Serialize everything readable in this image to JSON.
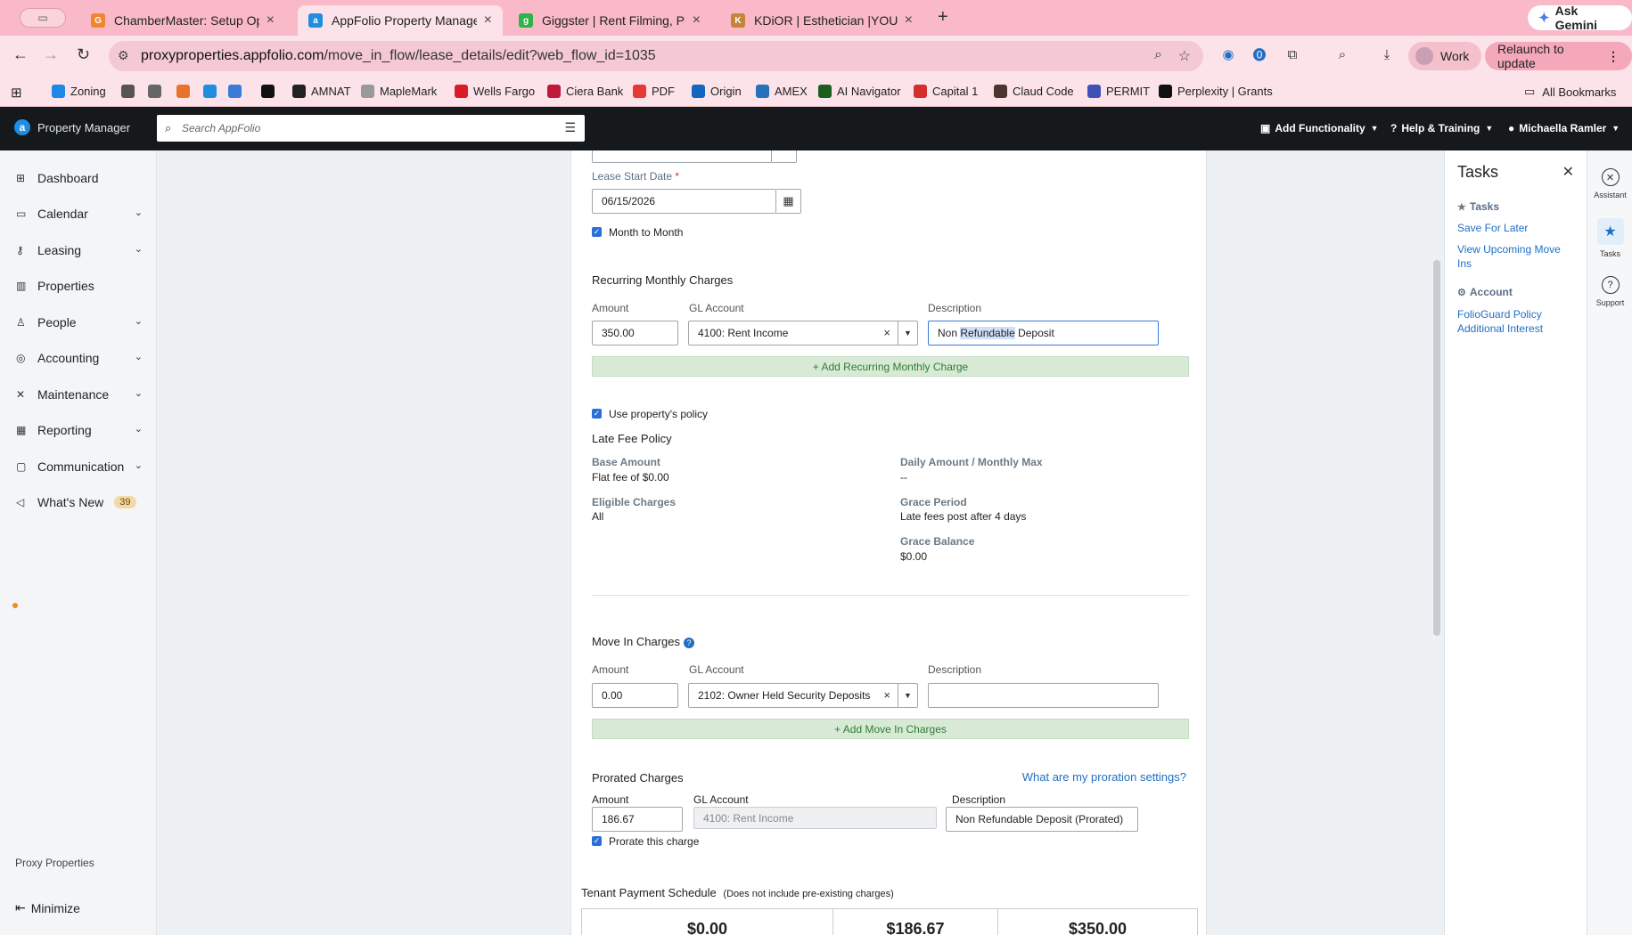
{
  "browser": {
    "tabs": [
      {
        "title": "ChamberMaster: Setup Optio",
        "icon": "chambermaster-icon",
        "color": "#f4842e",
        "glyph": "G"
      },
      {
        "title": "AppFolio Property Manager",
        "icon": "appfolio-icon",
        "color": "#1f8ee0",
        "glyph": "a"
      },
      {
        "title": "Giggster | Rent Filming, Photo",
        "icon": "giggster-icon",
        "color": "#2fb24a",
        "glyph": "g"
      },
      {
        "title": "KDiOR | Esthetician |YOU DE",
        "icon": "kdior-icon",
        "color": "#c4843a",
        "glyph": "K"
      }
    ],
    "gemini_label": "Ask Gemini",
    "url_host": "proxyproperties.appfolio.com",
    "url_path": "/move_in_flow/lease_details/edit?web_flow_id=1035",
    "work_label": "Work",
    "relaunch_label": "Relaunch to update",
    "bookmarks": [
      {
        "label": "Zoning",
        "color": "#1e88e5"
      },
      {
        "label": "",
        "color": "#555"
      },
      {
        "label": "",
        "color": "#666"
      },
      {
        "label": "",
        "color": "#e8742b"
      },
      {
        "label": "",
        "color": "#1f8ee0"
      },
      {
        "label": "",
        "color": "#3a7bd5"
      },
      {
        "label": "",
        "color": "#111"
      },
      {
        "label": "AMNAT",
        "color": "#222"
      },
      {
        "label": "MapleMark",
        "color": "#999"
      },
      {
        "label": "Wells Fargo",
        "color": "#d71e28"
      },
      {
        "label": "Ciera Bank",
        "color": "#c0183a"
      },
      {
        "label": "PDF",
        "color": "#e53935"
      },
      {
        "label": "Origin",
        "color": "#1565c0"
      },
      {
        "label": "AMEX",
        "color": "#2671b9"
      },
      {
        "label": "AI Navigator",
        "color": "#1b5e20"
      },
      {
        "label": "Capital 1",
        "color": "#d32f2f"
      },
      {
        "label": "Claud Code",
        "color": "#4e342e"
      },
      {
        "label": "PERMIT",
        "color": "#3f51b5"
      },
      {
        "label": "Perplexity | Grants",
        "color": "#111"
      }
    ],
    "all_bookmarks_label": "All Bookmarks"
  },
  "app": {
    "brand": "Property Manager",
    "search_placeholder": "Search AppFolio",
    "add_functionality": "Add Functionality",
    "help_training": "Help & Training",
    "user": "Michaella Ramler"
  },
  "nav": {
    "items": [
      {
        "label": "Dashboard",
        "icon": "dashboard-icon",
        "glyph": "⊞",
        "chevron": false
      },
      {
        "label": "Calendar",
        "icon": "calendar-icon",
        "glyph": "▭",
        "chevron": true
      },
      {
        "label": "Leasing",
        "icon": "key-icon",
        "glyph": "⚷",
        "chevron": true
      },
      {
        "label": "Properties",
        "icon": "building-icon",
        "glyph": "▥",
        "chevron": false
      },
      {
        "label": "People",
        "icon": "person-icon",
        "glyph": "♙",
        "chevron": true
      },
      {
        "label": "Accounting",
        "icon": "money-icon",
        "glyph": "◎",
        "chevron": true
      },
      {
        "label": "Maintenance",
        "icon": "tools-icon",
        "glyph": "✕",
        "chevron": true
      },
      {
        "label": "Reporting",
        "icon": "table-icon",
        "glyph": "▦",
        "chevron": true
      },
      {
        "label": "Communication",
        "icon": "chat-icon",
        "glyph": "▢",
        "chevron": true
      },
      {
        "label": "What's New",
        "icon": "megaphone-icon",
        "glyph": "◁",
        "chevron": false,
        "badge": "39"
      }
    ],
    "company": "Proxy Properties",
    "minimize": "Minimize"
  },
  "form": {
    "lease_start_label": "Lease Start Date",
    "lease_start_value": "06/15/2026",
    "month_to_month": "Month to Month",
    "recurring_title": "Recurring Monthly Charges",
    "col_amount": "Amount",
    "col_gl": "GL Account",
    "col_desc": "Description",
    "recurring_amount": "350.00",
    "recurring_gl": "4100: Rent Income",
    "recurring_desc_pre": "Non ",
    "recurring_desc_sel": "Refundable",
    "recurring_desc_post": " Deposit",
    "add_recurring": "+ Add Recurring Monthly Charge",
    "use_policy": "Use property's policy",
    "late_fee_title": "Late Fee Policy",
    "base_amount_k": "Base Amount",
    "base_amount_v": "Flat fee of $0.00",
    "daily_k": "Daily Amount / Monthly Max",
    "daily_v": "--",
    "eligible_k": "Eligible Charges",
    "eligible_v": "All",
    "grace_period_k": "Grace Period",
    "grace_period_v": "Late fees post after 4 days",
    "grace_balance_k": "Grace Balance",
    "grace_balance_v": "$0.00",
    "move_in_title": "Move In Charges",
    "move_in_amount": "0.00",
    "move_in_gl": "2102: Owner Held Security Deposits",
    "move_in_desc": "",
    "add_move_in": "+ Add Move In Charges",
    "prorated_title": "Prorated Charges",
    "proration_link": "What are my proration settings?",
    "prorated_amount": "186.67",
    "prorated_gl": "4100: Rent Income",
    "prorated_desc": "Non Refundable Deposit (Prorated)",
    "prorate_check": "Prorate this charge",
    "schedule_title": "Tenant Payment Schedule",
    "schedule_note": "(Does not include pre-existing charges)",
    "schedule_values": [
      "$0.00",
      "$186.67",
      "$350.00"
    ]
  },
  "tasks": {
    "title": "Tasks",
    "tasks_section": "Tasks",
    "save_later": "Save For Later",
    "view_upcoming": "View Upcoming Move Ins",
    "account_section": "Account",
    "folioguard": "FolioGuard Policy Additional Interest"
  },
  "rail": {
    "assistant": "Assistant",
    "tasks": "Tasks",
    "support": "Support"
  }
}
